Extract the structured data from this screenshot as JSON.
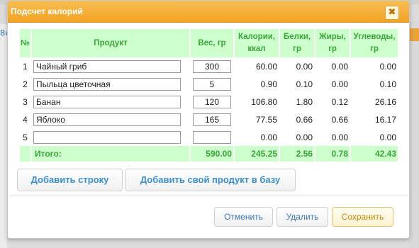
{
  "background": {
    "link_fragment": "Ве"
  },
  "dialog": {
    "title": "Подсчет калорий",
    "close_glyph": "✖"
  },
  "table": {
    "headers": {
      "index": "№",
      "product": "Продукт",
      "weight_line1": "Вес, гр",
      "calories_line1": "Калории,",
      "calories_line2": "ккал",
      "protein_line1": "Белки,",
      "protein_line2": "гр",
      "fat_line1": "Жиры,",
      "fat_line2": "гр",
      "carbs_line1": "Углеводы,",
      "carbs_line2": "гр"
    },
    "rows": [
      {
        "index": "1",
        "product": "Чайный гриб",
        "weight": "300",
        "calories": "60.00",
        "protein": "0.00",
        "fat": "0.00",
        "carbs": "0.00"
      },
      {
        "index": "2",
        "product": "Пыльца цветочная",
        "weight": "5",
        "calories": "0.90",
        "protein": "0.10",
        "fat": "0.00",
        "carbs": "0.10"
      },
      {
        "index": "3",
        "product": "Банан",
        "weight": "120",
        "calories": "106.80",
        "protein": "1.80",
        "fat": "0.12",
        "carbs": "26.16"
      },
      {
        "index": "4",
        "product": "Яблоко",
        "weight": "165",
        "calories": "77.55",
        "protein": "0.66",
        "fat": "0.66",
        "carbs": "16.17"
      },
      {
        "index": "5",
        "product": "",
        "weight": "",
        "calories": "0.00",
        "protein": "0.00",
        "fat": "0.00",
        "carbs": "0.00"
      }
    ],
    "total": {
      "label": "Итого:",
      "weight": "590.00",
      "calories": "245.25",
      "protein": "2.56",
      "fat": "0.78",
      "carbs": "42.43"
    }
  },
  "buttons": {
    "add_row": "Добавить строку",
    "add_product": "Добавить свой продукт в базу",
    "cancel": "Отменить",
    "delete": "Удалить",
    "save": "Сохранить"
  },
  "colors": {
    "title_bar": "#f2a323",
    "header_bg": "#ccffcc",
    "header_text": "#3aa63a",
    "link_text": "#3a8fd0"
  }
}
